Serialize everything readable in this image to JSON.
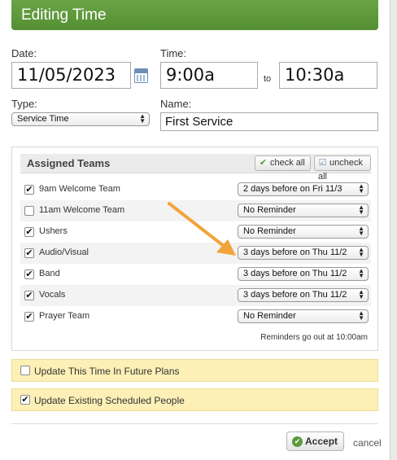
{
  "dialog": {
    "title": "Editing Time",
    "date": {
      "label": "Date:",
      "value": "11/05/2023",
      "icon": "calendar-icon"
    },
    "time": {
      "label": "Time:",
      "start": "9:00a",
      "separator": "to",
      "end": "10:30a"
    },
    "type": {
      "label": "Type:",
      "selected": "Service Time"
    },
    "name": {
      "label": "Name:",
      "value": "First Service"
    }
  },
  "teams": {
    "title": "Assigned Teams",
    "check_all": "check all",
    "uncheck_all": "uncheck all",
    "rows": [
      {
        "name": "9am Welcome Team",
        "checked": true,
        "reminder": "2 days before on Fri 11/3"
      },
      {
        "name": "11am Welcome Team",
        "checked": false,
        "reminder": "No Reminder"
      },
      {
        "name": "Ushers",
        "checked": true,
        "reminder": "No Reminder"
      },
      {
        "name": "Audio/Visual",
        "checked": true,
        "reminder": "3 days before on Thu 11/2"
      },
      {
        "name": "Band",
        "checked": true,
        "reminder": "3 days before on Thu 11/2"
      },
      {
        "name": "Vocals",
        "checked": true,
        "reminder": "3 days before on Thu 11/2"
      },
      {
        "name": "Prayer Team",
        "checked": true,
        "reminder": "No Reminder"
      }
    ],
    "footnote": "Reminders go out at 10:00am"
  },
  "options": {
    "update_future": {
      "label": "Update This Time In Future Plans",
      "checked": false
    },
    "update_existing": {
      "label": "Update Existing Scheduled People",
      "checked": true
    }
  },
  "actions": {
    "accept": "Accept",
    "cancel": "cancel"
  },
  "colors": {
    "title_bar": "#5f9a3c",
    "option_bg": "#fcf0b6",
    "annotation_arrow": "#f2a33a"
  }
}
